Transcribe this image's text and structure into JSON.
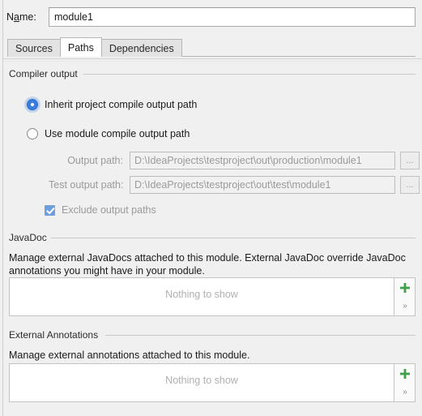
{
  "dialog": {
    "name_label": "Name:",
    "name_label_mnemonic": "a",
    "name_value": "module1"
  },
  "tabs": [
    {
      "label": "Sources",
      "active": false
    },
    {
      "label": "Paths",
      "active": true
    },
    {
      "label": "Dependencies",
      "active": false
    }
  ],
  "compiler_output": {
    "group_title": "Compiler output",
    "radio_inherit": {
      "label": "Inherit project compile output path",
      "selected": true
    },
    "radio_use_module": {
      "label": "Use module compile output path",
      "selected": false
    },
    "output_path": {
      "label": "Output path:",
      "value": "D:\\IdeaProjects\\testproject\\out\\production\\module1",
      "browse_label": "...",
      "enabled": false
    },
    "test_output_path": {
      "label": "Test output path:",
      "value": "D:\\IdeaProjects\\testproject\\out\\test\\module1",
      "browse_label": "...",
      "enabled": false
    },
    "exclude_checkbox": {
      "label": "Exclude output paths",
      "checked": true,
      "enabled": false
    }
  },
  "javadoc": {
    "group_title": "JavaDoc",
    "description": "Manage external JavaDocs attached to this module. External JavaDoc override JavaDoc annotations you might have in your module.",
    "empty_text": "Nothing to show",
    "add_icon": "plus-icon",
    "expand_icon": "chevron-double-right-icon"
  },
  "external_annotations": {
    "group_title": "External Annotations",
    "description": "Manage external annotations attached to this module.",
    "empty_text": "Nothing to show",
    "add_icon": "plus-icon",
    "expand_icon": "chevron-double-right-icon"
  },
  "colors": {
    "accent_blue": "#3b7ddd",
    "add_green": "#3fa04a",
    "background": "#f0f0f0",
    "disabled_text": "#9a9a9a"
  }
}
